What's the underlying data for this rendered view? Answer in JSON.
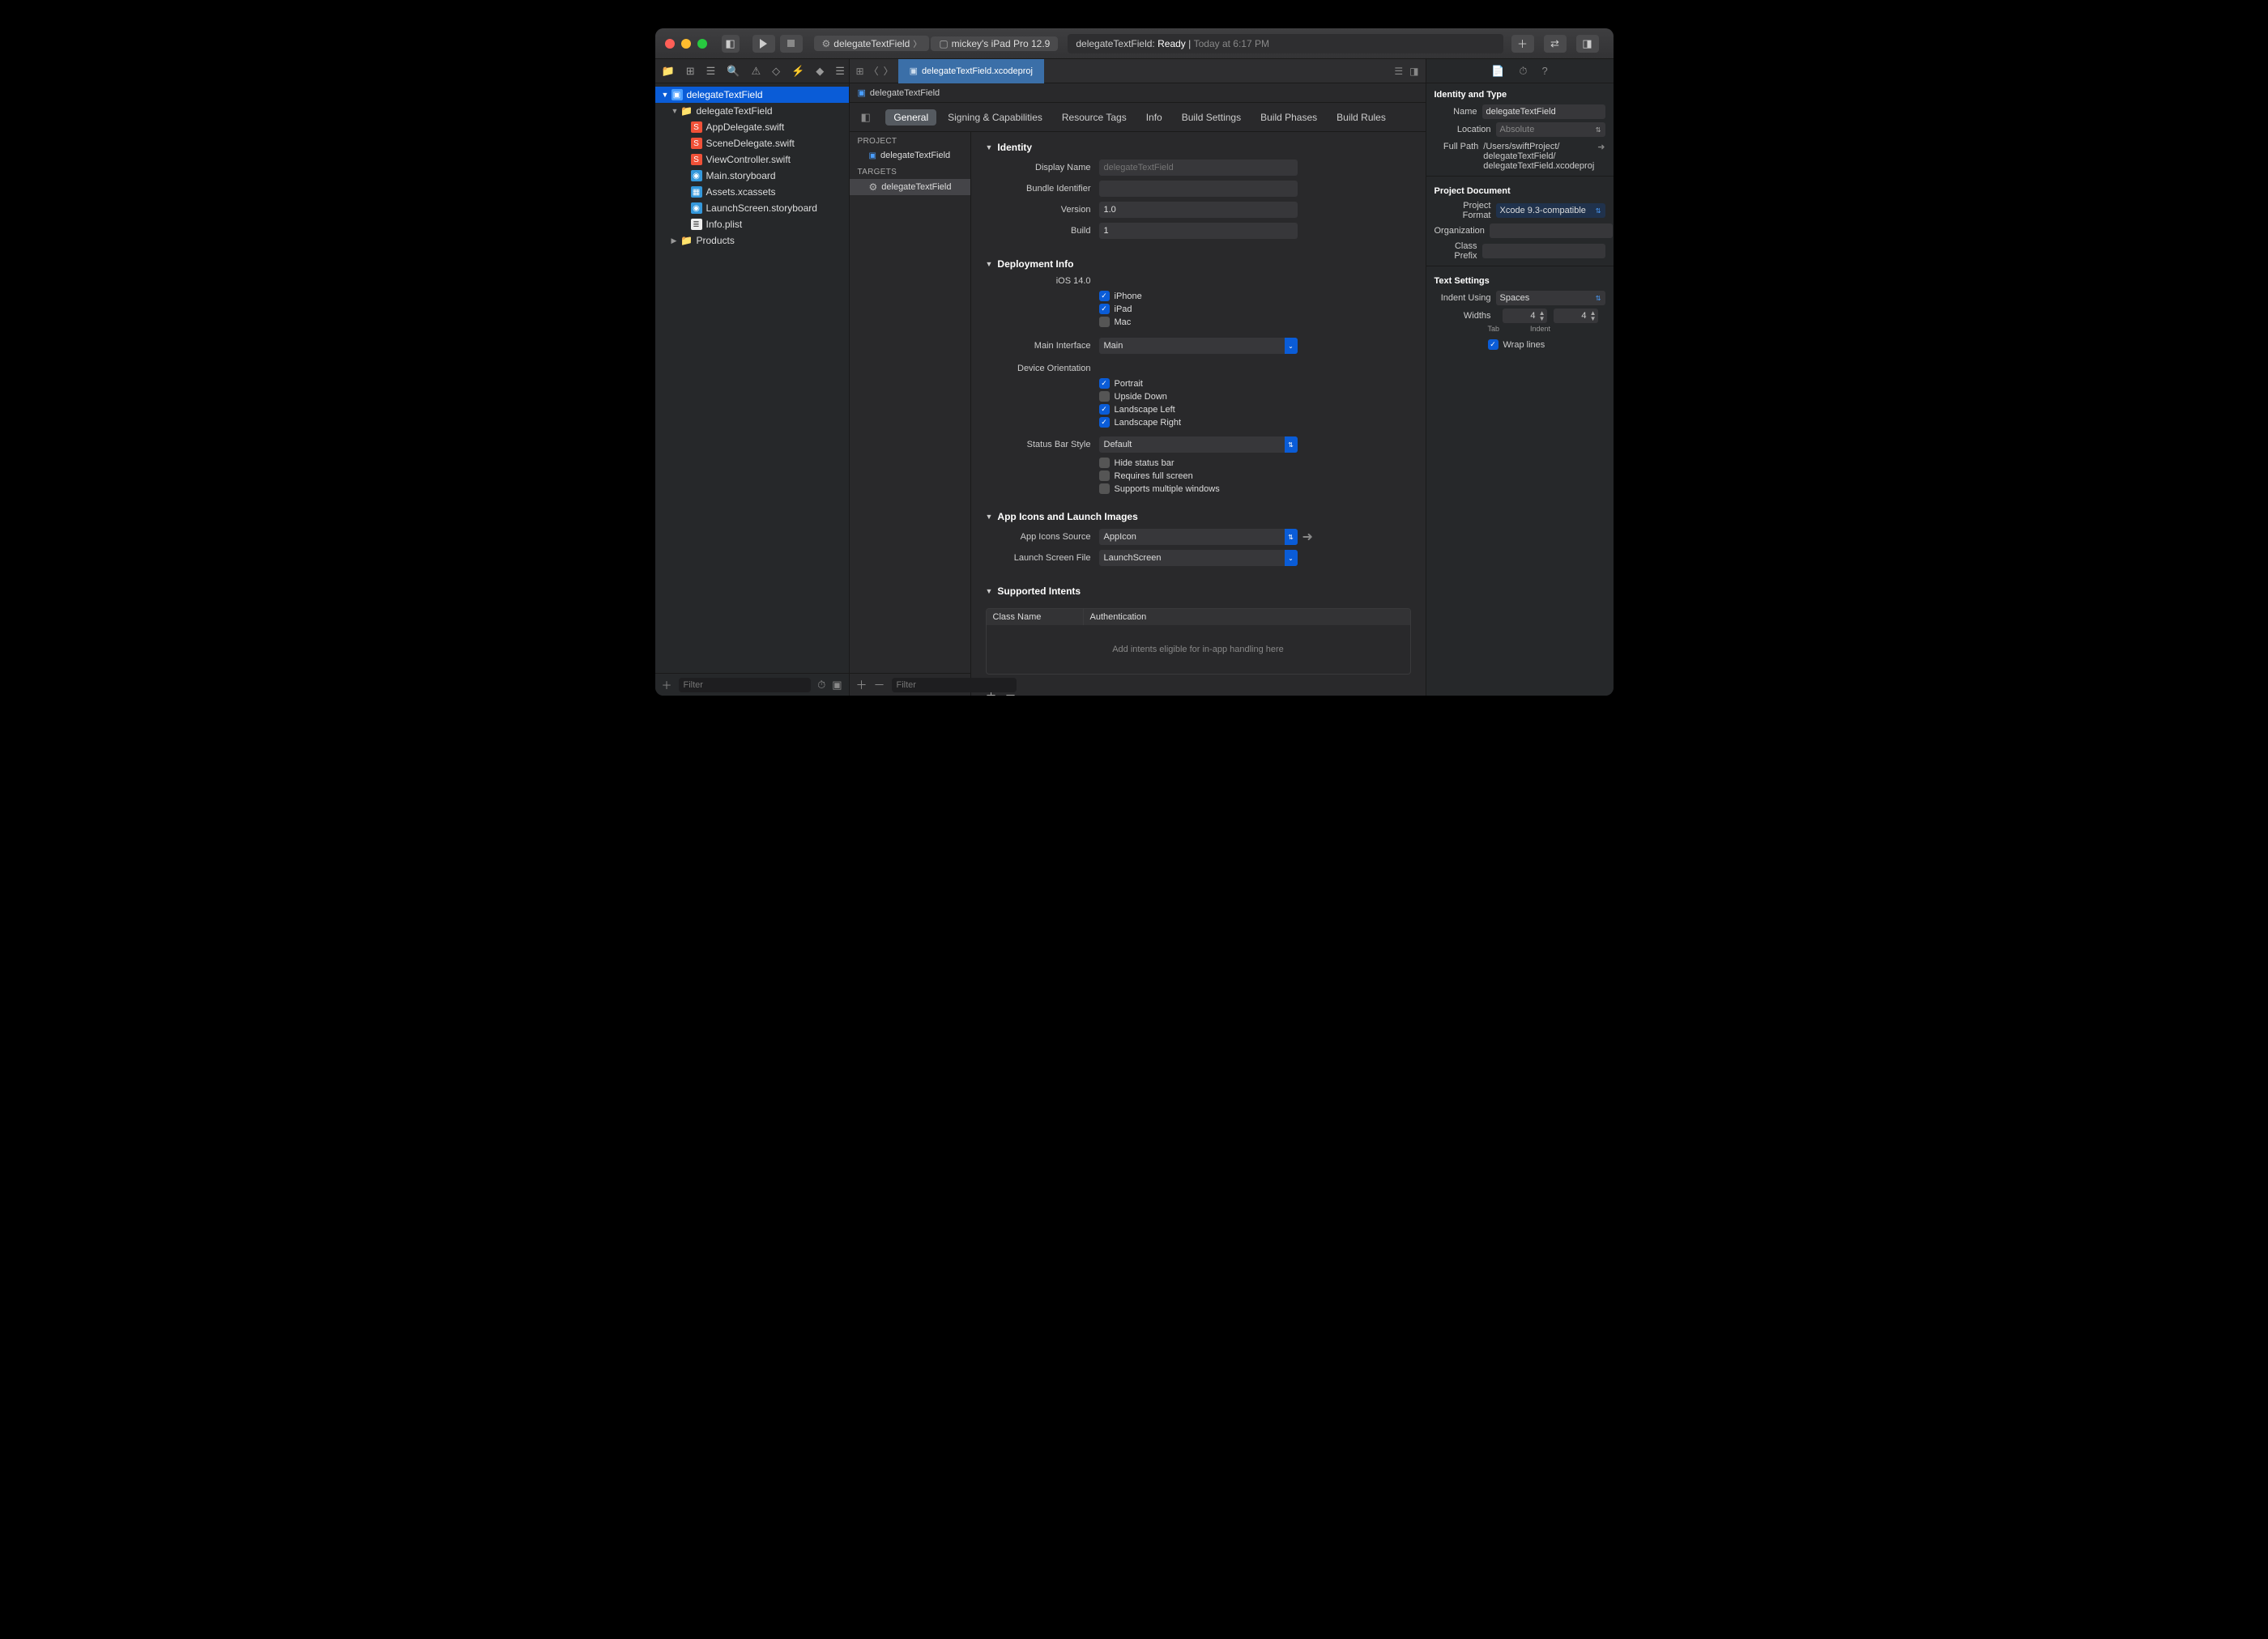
{
  "titlebar": {
    "scheme": "delegateTextField",
    "device": "mickey's iPad Pro 12.9",
    "status_project": "delegateTextField:",
    "status_state": "Ready",
    "status_time": "Today at 6:17 PM"
  },
  "navigator": {
    "root": "delegateTextField",
    "group": "delegateTextField",
    "files": [
      "AppDelegate.swift",
      "SceneDelegate.swift",
      "ViewController.swift",
      "Main.storyboard",
      "Assets.xcassets",
      "LaunchScreen.storyboard",
      "Info.plist"
    ],
    "products": "Products",
    "filter_placeholder": "Filter"
  },
  "tabs": {
    "active": "delegateTextField.xcodeproj",
    "jump": "delegateTextField"
  },
  "targetlist": {
    "project_hdr": "PROJECT",
    "project": "delegateTextField",
    "targets_hdr": "TARGETS",
    "target": "delegateTextField",
    "filter_placeholder": "Filter"
  },
  "segments": [
    "General",
    "Signing & Capabilities",
    "Resource Tags",
    "Info",
    "Build Settings",
    "Build Phases",
    "Build Rules"
  ],
  "identity": {
    "header": "Identity",
    "display_name_lbl": "Display Name",
    "display_name": "delegateTextField",
    "bundle_lbl": "Bundle Identifier",
    "bundle": "",
    "version_lbl": "Version",
    "version": "1.0",
    "build_lbl": "Build",
    "build": "1"
  },
  "deploy": {
    "header": "Deployment Info",
    "ios_lbl": "iOS 14.0",
    "iphone": "iPhone",
    "ipad": "iPad",
    "mac": "Mac",
    "main_if_lbl": "Main Interface",
    "main_if": "Main",
    "orient_lbl": "Device Orientation",
    "portrait": "Portrait",
    "upside": "Upside Down",
    "land_l": "Landscape Left",
    "land_r": "Landscape Right",
    "status_lbl": "Status Bar Style",
    "status_val": "Default",
    "hide_status": "Hide status bar",
    "full_screen": "Requires full screen",
    "multi_win": "Supports multiple windows"
  },
  "appicons": {
    "header": "App Icons and Launch Images",
    "src_lbl": "App Icons Source",
    "src": "AppIcon",
    "launch_lbl": "Launch Screen File",
    "launch": "LaunchScreen"
  },
  "intents": {
    "header": "Supported Intents",
    "col1": "Class Name",
    "col2": "Authentication",
    "empty": "Add intents eligible for in-app handling here"
  },
  "inspector": {
    "identity_hdr": "Identity and Type",
    "name_lbl": "Name",
    "name": "delegateTextField",
    "location_lbl": "Location",
    "location": "Absolute",
    "fullpath_lbl": "Full Path",
    "fullpath": "/Users/swiftProject/\ndelegateTextField/\ndelegateTextField.xcodeproj",
    "projdoc_hdr": "Project Document",
    "format_lbl": "Project Format",
    "format": "Xcode 9.3-compatible",
    "org_lbl": "Organization",
    "org": "",
    "prefix_lbl": "Class Prefix",
    "prefix": "",
    "text_hdr": "Text Settings",
    "indent_lbl": "Indent Using",
    "indent": "Spaces",
    "widths_lbl": "Widths",
    "tab_w": "4",
    "indent_w": "4",
    "tab_sub": "Tab",
    "indent_sub": "Indent",
    "wrap": "Wrap lines"
  }
}
